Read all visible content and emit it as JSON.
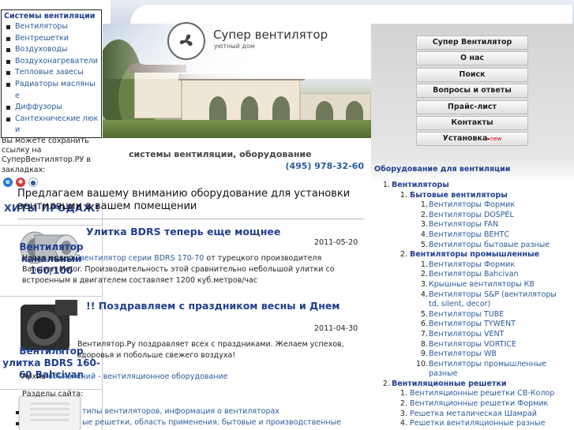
{
  "site": {
    "title": "Супер вентилятор",
    "subtitle": "уютный дом"
  },
  "left_menu": {
    "title": "Системы вентиляции",
    "items": [
      "Вентиляторы",
      "Вентрешетки",
      "Воздуховоды",
      "Воздухонагреватели",
      "Тепловые завесы",
      "Радиаторы масляные",
      "Диффузоры",
      "Сантехнические люки"
    ]
  },
  "bookmark_text": "Вы можете сохранить ссылку на СуперВентилятор.РУ в закладках:",
  "hits": {
    "title": "ХИТЫ ПРОДАЖ!",
    "products": [
      {
        "name": "Вентилятор канальный 160/100"
      },
      {
        "name": "Вентилятор улитка BDRS 160-60 Bahcivan"
      }
    ]
  },
  "center": {
    "heading": "системы вентиляции, оборудование",
    "phone": "(495) 978-32-60",
    "intro": "Предлагаем вашему вниманию оборудование для установки вентиляции в вашем помещении",
    "news": [
      {
        "title": "Улитка BDRS теперь еще мощнее",
        "date": "2011-05-20",
        "text_before": "Новая модель ",
        "link": "вентилятор серии BDRS 170-70",
        "text_after": " от турецкого производителя Bahcivan Motor. Производительность этой сравнительно небольшой улитки со встроенным в двигателем составляет 1200 куб.метров/час"
      },
      {
        "title": "!! Поздравляем с праздником весны и Днем",
        "date": "2011-04-30",
        "text": "Вентилятор.Ру поздравляет всех с праздниками. Желаем успехов, здоровья и побольше свежего воздуха!"
      }
    ],
    "archive_label": "Архив",
    "archive_link": "объявлений - вентиляционное оборудование",
    "sections_label": "Разделы сайта:",
    "section_items": [
      "типы вентиляторов, информация о вентиляторах",
      "ые решетки, область применения, бытовые и производственные"
    ]
  },
  "nav": {
    "buttons": [
      "Супер Вентилятор",
      "О нас",
      "Поиск",
      "Вопросы и ответы",
      "Прайс-лист",
      "Контакты",
      "Установка"
    ],
    "new_badge": "new"
  },
  "equipment": {
    "title": "Оборудование для вентиляции",
    "rows": [
      {
        "num": "1.",
        "label": "Вентиляторы",
        "level": 0,
        "bold": true
      },
      {
        "num": "1.",
        "label": "Бытовые вентиляторы",
        "level": 1,
        "bold": true
      },
      {
        "num": "1.",
        "label": "Вентиляторы Формик",
        "level": 2
      },
      {
        "num": "2.",
        "label": "Вентиляторы DOSPEL",
        "level": 2
      },
      {
        "num": "3.",
        "label": "Вентиляторы FAN",
        "level": 2
      },
      {
        "num": "4.",
        "label": "Вентиляторы ВЕНТС",
        "level": 2
      },
      {
        "num": "5.",
        "label": "Вентиляторы бытовые разные",
        "level": 2
      },
      {
        "num": "2.",
        "label": "Вентиляторы промышленные",
        "level": 1,
        "bold": true
      },
      {
        "num": "1.",
        "label": "Вентиляторы Формик",
        "level": 2
      },
      {
        "num": "2.",
        "label": "Вентиляторы Bahcivan",
        "level": 2
      },
      {
        "num": "3.",
        "label": "Крышные вентиляторы КВ",
        "level": 2
      },
      {
        "num": "4.",
        "label": "Вентиляторы S&P (вентиляторы",
        "level": 2
      },
      {
        "num": "",
        "label": "td, silent, decor)",
        "level": 2
      },
      {
        "num": "5.",
        "label": "Вентиляторы TUBE",
        "level": 2
      },
      {
        "num": "6.",
        "label": "Вентиляторы TYWENT",
        "level": 2
      },
      {
        "num": "7.",
        "label": "Вентиляторы VENT",
        "level": 2
      },
      {
        "num": "8.",
        "label": "Вентиляторы VORTICE",
        "level": 2
      },
      {
        "num": "9.",
        "label": "Вентиляторы WB",
        "level": 2
      },
      {
        "num": "10.",
        "label": "Вентиляторы промышленные",
        "level": 2
      },
      {
        "num": "",
        "label": "разные",
        "level": 2
      },
      {
        "num": "2.",
        "label": "Вентиляционные решетки",
        "level": 0,
        "bold": true
      },
      {
        "num": "1.",
        "label": "Вентиляционные решетки СВ-Колор",
        "level": 1
      },
      {
        "num": "2.",
        "label": "Вентиляционные решетки Формик",
        "level": 1
      },
      {
        "num": "3.",
        "label": "Решетка металическая Шамрай",
        "level": 1
      },
      {
        "num": "4.",
        "label": "Решетки вентиляционные разные",
        "level": 1
      }
    ]
  },
  "colors": {
    "link": "#2a5a9a",
    "heading": "#1f3f8f",
    "badge": "#cc0000"
  }
}
